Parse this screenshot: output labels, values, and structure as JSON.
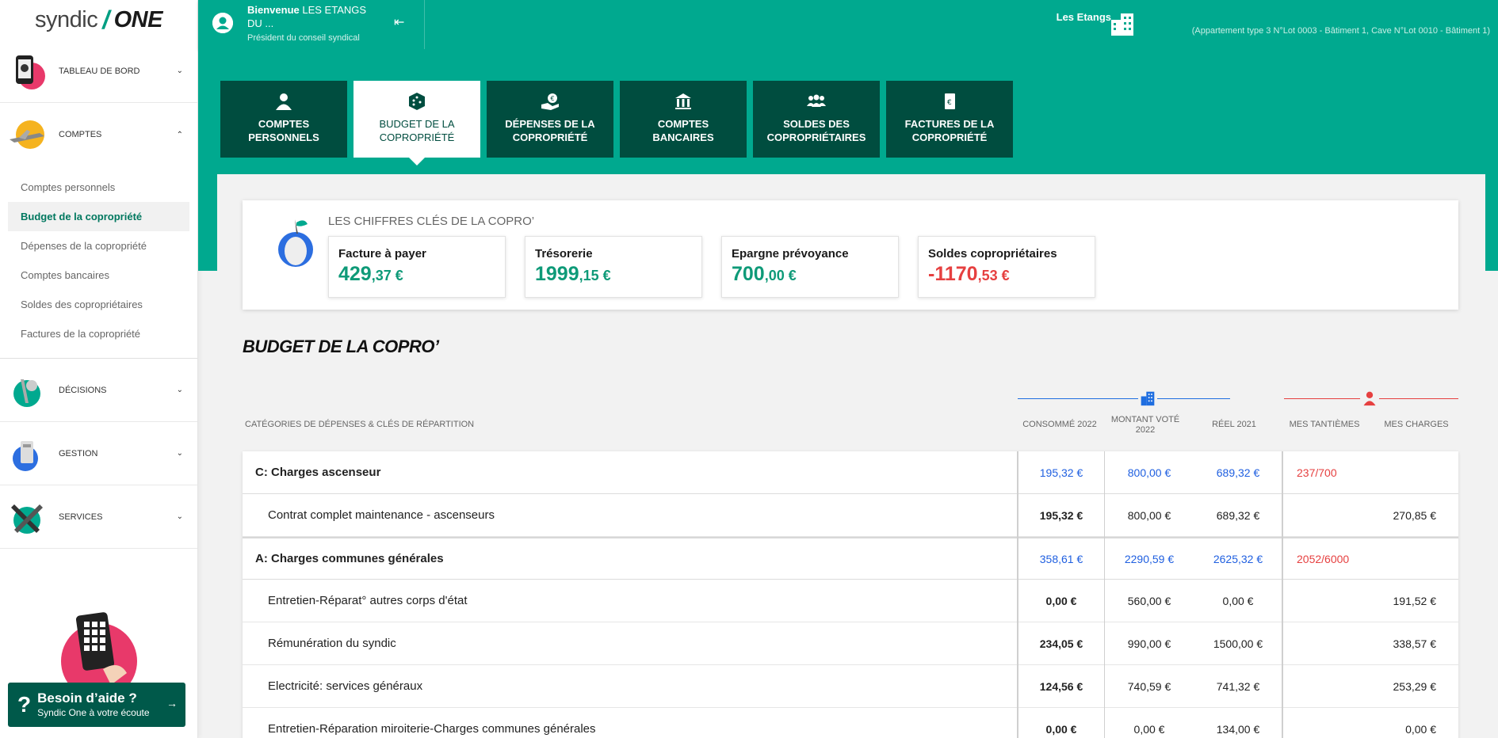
{
  "logo": {
    "part1": "syndic",
    "slash": "/",
    "part2": "ONE"
  },
  "sidebar": {
    "groups": [
      {
        "label": "TABLEAU DE BORD"
      },
      {
        "label": "COMPTES"
      },
      {
        "label": "DÉCISIONS"
      },
      {
        "label": "GESTION"
      },
      {
        "label": "SERVICES"
      }
    ],
    "sub_items": [
      "Comptes personnels",
      "Budget de la copropriété",
      "Dépenses de la copropriété",
      "Comptes bancaires",
      "Soldes des copropriétaires",
      "Factures de la copropriété"
    ],
    "help": {
      "title": "Besoin d’aide ?",
      "subtitle": "Syndic One à votre écoute"
    }
  },
  "header": {
    "welcome_bold": "Bienvenue",
    "welcome_name": "LES ETANGS DU ...",
    "role": "Président du conseil syndical",
    "residence_name": "Les Etangs",
    "residence_detail": "(Appartement type 3 N°Lot 0003 - Bâtiment 1, Cave N°Lot 0010 - Bâtiment 1)"
  },
  "tabs": [
    {
      "line1": "COMPTES",
      "line2": "PERSONNELS",
      "icon": "user-icon"
    },
    {
      "line1": "BUDGET DE LA",
      "line2": "COPROPRIÉTÉ",
      "icon": "dice-icon"
    },
    {
      "line1": "DÉPENSES DE LA",
      "line2": "COPROPRIÉTÉ",
      "icon": "hand-euro-icon"
    },
    {
      "line1": "COMPTES",
      "line2": "BANCAIRES",
      "icon": "bank-icon"
    },
    {
      "line1": "SOLDES DES",
      "line2": "COPROPRIÉTAIRES",
      "icon": "users-icon"
    },
    {
      "line1": "FACTURES DE LA",
      "line2": "COPROPRIÉTÉ",
      "icon": "invoice-icon"
    }
  ],
  "keyfigures": {
    "title": "LES CHIFFRES CLÉS DE LA COPRO’",
    "items": [
      {
        "label": "Facture à payer",
        "int": "429",
        "dec": ",37 €",
        "negative": false
      },
      {
        "label": "Trésorerie",
        "int": "1999",
        "dec": ",15 €",
        "negative": false
      },
      {
        "label": "Epargne prévoyance",
        "int": "700",
        "dec": ",00 €",
        "negative": false
      },
      {
        "label": "Soldes copropriétaires",
        "int": "-1170",
        "dec": ",53 €",
        "negative": true
      }
    ]
  },
  "budget": {
    "title": "BUDGET DE LA COPRO’",
    "columns": {
      "category": "CATÉGORIES DE DÉPENSES & CLÉS DE RÉPARTITION",
      "consumed": "CONSOMMÉ 2022",
      "voted": "MONTANT VOTÉ 2022",
      "real": "RÉEL 2021",
      "tantiemes": "MES TANTIÈMES",
      "charges": "MES CHARGES"
    },
    "rows": [
      {
        "type": "cat",
        "name": "C: Charges ascenseur",
        "consumed": "195,32 €",
        "voted": "800,00 €",
        "real": "689,32 €",
        "tantiemes": "237/700",
        "charges": ""
      },
      {
        "type": "sub",
        "name": "Contrat complet maintenance - ascenseurs",
        "consumed": "195,32 €",
        "voted": "800,00 €",
        "real": "689,32 €",
        "tantiemes": "",
        "charges": "270,85 €"
      },
      {
        "type": "cat",
        "name": "A: Charges communes générales",
        "consumed": "358,61 €",
        "voted": "2290,59 €",
        "real": "2625,32 €",
        "tantiemes": "2052/6000",
        "charges": ""
      },
      {
        "type": "sub",
        "name": "Entretien-Réparat° autres corps d'état",
        "consumed": "0,00 €",
        "voted": "560,00 €",
        "real": "0,00 €",
        "tantiemes": "",
        "charges": "191,52 €"
      },
      {
        "type": "sub",
        "name": "Rémunération du syndic",
        "consumed": "234,05 €",
        "voted": "990,00 €",
        "real": "1500,00 €",
        "tantiemes": "",
        "charges": "338,57 €"
      },
      {
        "type": "sub",
        "name": "Electricité: services généraux",
        "consumed": "124,56 €",
        "voted": "740,59 €",
        "real": "741,32 €",
        "tantiemes": "",
        "charges": "253,29 €"
      },
      {
        "type": "sub",
        "name": "Entretien-Réparation miroiterie-Charges communes générales",
        "consumed": "0,00 €",
        "voted": "0,00 €",
        "real": "134,00 €",
        "tantiemes": "",
        "charges": "0,00 €"
      }
    ]
  },
  "colors": {
    "accent": "#00a98f",
    "dark": "#004d3f",
    "blue": "#1f5fe0",
    "red": "#e64040"
  }
}
